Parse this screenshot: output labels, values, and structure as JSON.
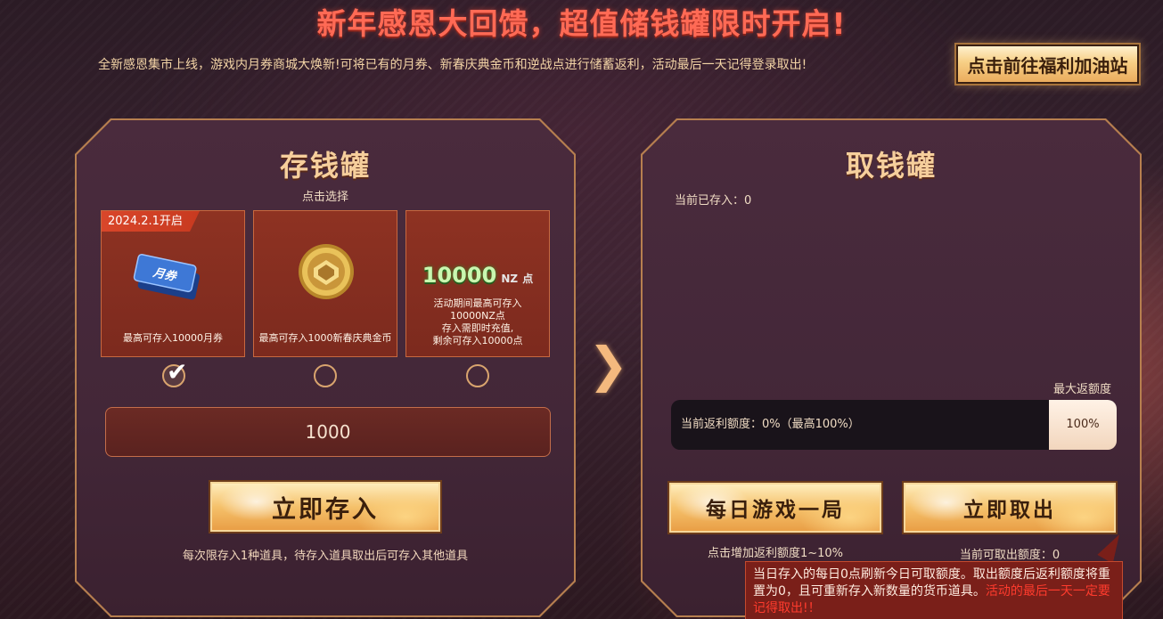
{
  "header": {
    "title": "新年感恩大回馈，超值储钱罐限时开启!",
    "subtitle": "全新感恩集市上线，游戏内月券商城大焕新!可将已有的月券、新春庆典金币和逆战点进行储蓄返利，活动最后一天记得登录取出!",
    "cta_label": "点击前往福利加油站"
  },
  "deposit_panel": {
    "title": "存钱罐",
    "hint": "点击选择",
    "cards": [
      {
        "badge": "2024.2.1开启",
        "icon": "voucher-icon",
        "icon_text": "月券",
        "desc": "最高可存入10000月券",
        "selected": true
      },
      {
        "icon": "gold-coin-icon",
        "desc": "最高可存入1000新春庆典金币",
        "selected": false
      },
      {
        "icon": "nz-points-icon",
        "icon_number": "10000",
        "icon_unit": "NZ",
        "icon_suffix": "点",
        "desc_lines": [
          "活动期间最高可存入",
          "10000NZ点",
          "存入需即时充值,",
          "剩余可存入10000点"
        ],
        "selected": false
      }
    ],
    "amount_value": "1000",
    "deposit_button": "立即存入",
    "note": "每次限存入1种道具，待存入道具取出后可存入其他道具"
  },
  "withdraw_panel": {
    "title": "取钱罐",
    "deposited_label": "当前已存入：0",
    "max_rebate_label": "最大返额度",
    "rebate_progress": 0,
    "rebate_text": "当前返利额度：0%（最高100%）",
    "rebate_max_value": "100%",
    "daily_button": "每日游戏一局",
    "withdraw_button": "立即取出",
    "daily_note": "点击增加返利额度1~10%",
    "withdraw_note": "当前可取出额度：0"
  },
  "tooltip": {
    "text": "当日存入的每日0点刷新今日可取额度。取出额度后返利额度将重置为0，且可重新存入新数量的货币道具。",
    "warning": "活动的最后一天一定要记得取出!！"
  },
  "colors": {
    "title_red": "#ff6a55",
    "gold": "#f6cf9c",
    "card_red": "#8e3222",
    "tooltip_bg": "#7a1f19",
    "warning_red": "#ff3b2d"
  }
}
